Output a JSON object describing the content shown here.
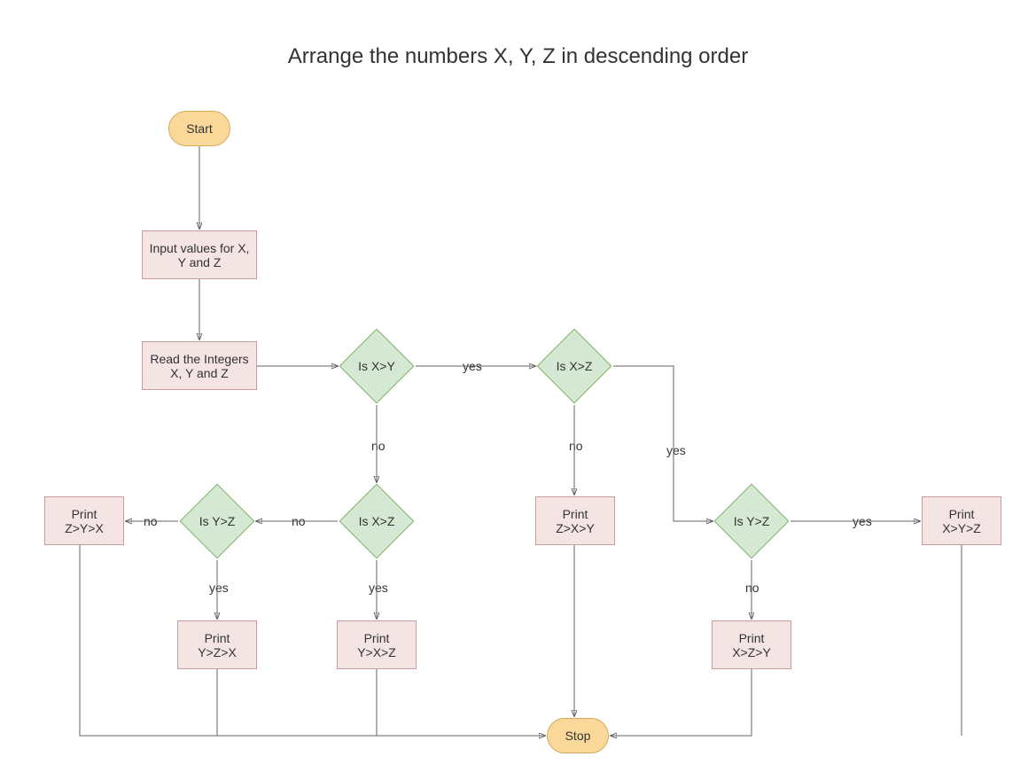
{
  "title": "Arrange the numbers X, Y, Z in descending order",
  "nodes": {
    "start": "Start",
    "input": "Input values for X, Y and Z",
    "read": "Read the Integers X, Y and Z",
    "isXY": "Is X>Y",
    "isXZ_top": "Is X>Z",
    "isYZ_left": "Is Y>Z",
    "isXZ_mid": "Is X>Z",
    "isYZ_right": "Is Y>Z",
    "printZYX": "Print\nZ>Y>X",
    "printZXY": "Print\nZ>X>Y",
    "printXYZ": "Print\nX>Y>Z",
    "printYZX": "Print\nY>Z>X",
    "printYXZ": "Print\nY>X>Z",
    "printXZY": "Print\nX>Z>Y",
    "stop": "Stop"
  },
  "edges": {
    "yes": "yes",
    "no": "no"
  }
}
